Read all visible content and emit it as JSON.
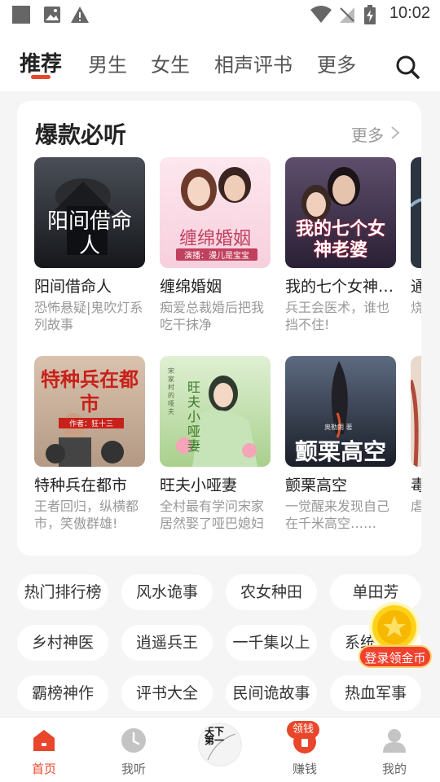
{
  "status_bar": {
    "time": "10:02"
  },
  "top_tabs": [
    {
      "label": "推荐",
      "active": true
    },
    {
      "label": "男生"
    },
    {
      "label": "女生"
    },
    {
      "label": "相声评书"
    },
    {
      "label": "更多"
    }
  ],
  "hot_section": {
    "title": "爆款必听",
    "more": "更多",
    "books": [
      {
        "name": "阳间借命人",
        "desc": "恐怖悬疑|鬼吹灯系列故事",
        "cover_text": "阳间借命人"
      },
      {
        "name": "缠绵婚姻",
        "desc": "痴爱总裁婚后把我吃干抹净",
        "cover_text": "缠绵婚姻",
        "cover_sub": "演播：漫儿是宝宝"
      },
      {
        "name": "我的七个女神…",
        "desc": "兵王会医术，谁也挡不住!",
        "cover_text": "我的七个女神老婆"
      },
      {
        "name": "通",
        "desc": "烧身",
        "cover_text": ""
      },
      {
        "name": "特种兵在都市",
        "desc": "王者回归，纵横都市，笑傲群雄!",
        "cover_text": "特种兵在都市",
        "cover_sub": "作者：狂十三"
      },
      {
        "name": "旺夫小哑妻",
        "desc": "全村最有学问宋家居然娶了哑巴媳妇",
        "cover_text": "旺夫小哑妻",
        "cover_sub": "宋家村的哑夫"
      },
      {
        "name": "颤栗高空",
        "desc": "一觉醒来发现自己在千米高空……",
        "cover_text": "颤栗高空",
        "cover_sub": "奥勒朗 著"
      },
      {
        "name": "毒",
        "desc": "虐个",
        "cover_text": ""
      }
    ]
  },
  "tags": [
    "热门排行榜",
    "风水诡事",
    "农女种田",
    "单田芳",
    "乡村神医",
    "逍遥兵王",
    "一千集以上",
    "系统",
    "霸榜神作",
    "评书大全",
    "民间诡故事",
    "热血军事"
  ],
  "floating_coin": {
    "label": "登录领金币"
  },
  "bottom_nav": [
    {
      "label": "首页",
      "active": true
    },
    {
      "label": "我听"
    },
    {
      "label": "",
      "center_text": "天下第一"
    },
    {
      "label": "赚钱",
      "badge": "领钱"
    },
    {
      "label": "我的"
    }
  ],
  "colors": {
    "accent": "#e8472c",
    "coin": "#ffd21a"
  }
}
